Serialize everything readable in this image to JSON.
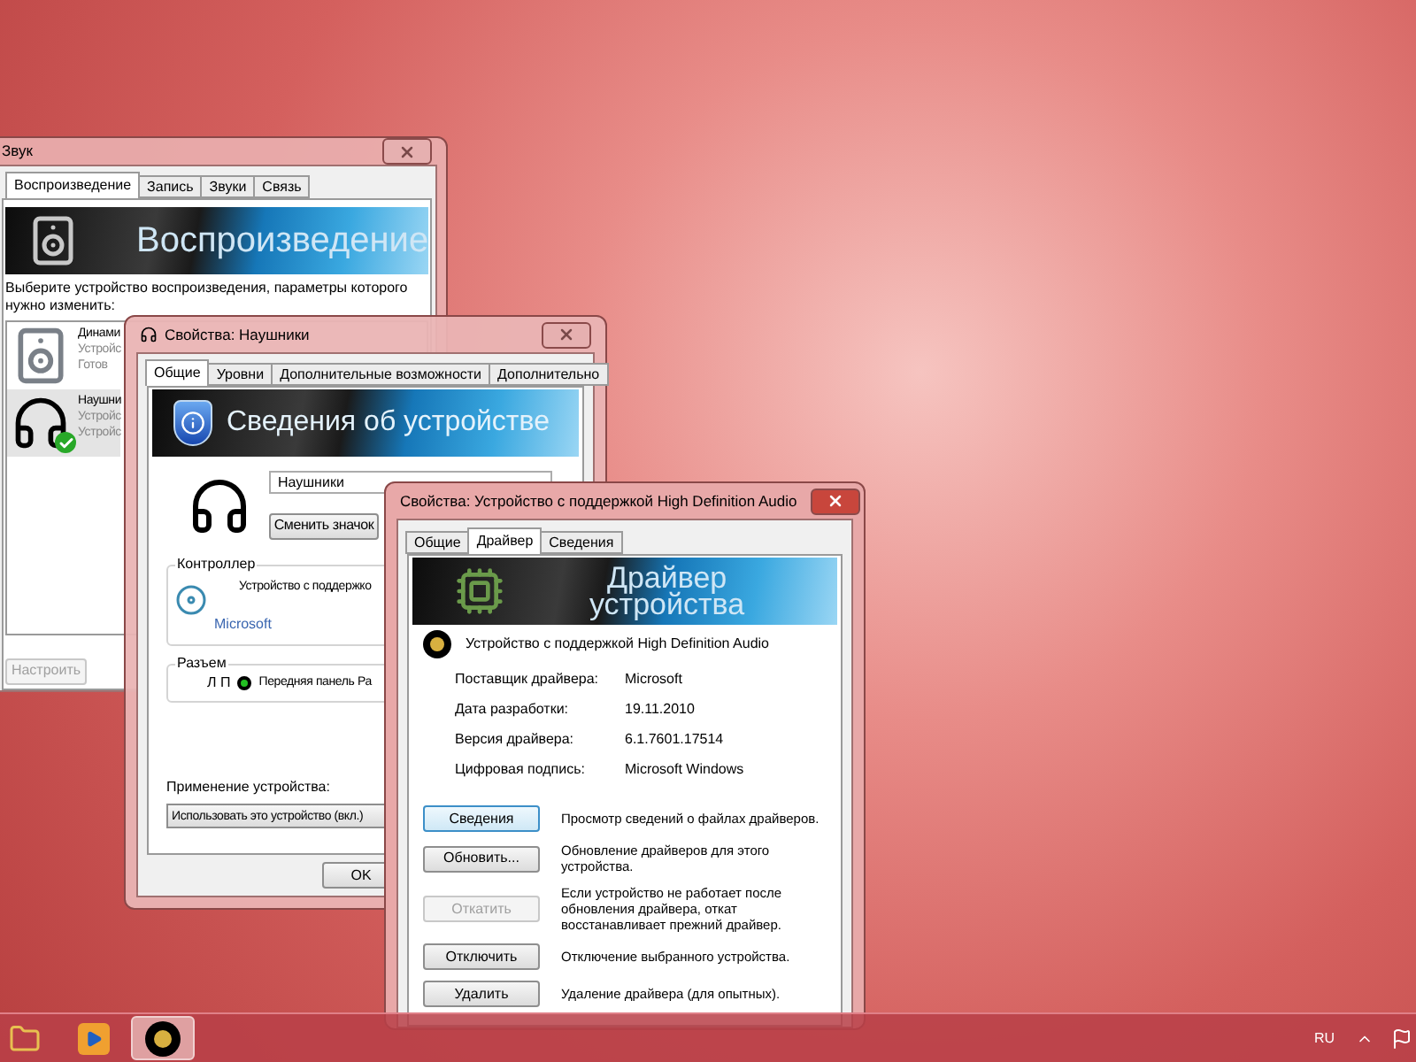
{
  "sound_window": {
    "title": "Звук",
    "tabs": [
      {
        "label": "Воспроизведение",
        "selected": true
      },
      {
        "label": "Запись",
        "selected": false
      },
      {
        "label": "Звуки",
        "selected": false
      },
      {
        "label": "Связь",
        "selected": false
      }
    ],
    "banner": "Воспроизведение",
    "prompt": "Выберите устройство воспроизведения, параметры которого нужно изменить:",
    "devices": [
      {
        "kind": "speaker",
        "name": "Динами",
        "line_2": "Устройс",
        "line_3": "Готов",
        "selected": false,
        "default": false
      },
      {
        "kind": "headphones",
        "name": "Наушни",
        "line_2": "Устройс",
        "line_3": "Устройс",
        "selected": true,
        "default": true
      }
    ],
    "configure_button": {
      "label": "Настроить",
      "disabled": true
    }
  },
  "headphones_window": {
    "title": "Свойства: Наушники",
    "tabs": [
      {
        "label": "Общие",
        "selected": true
      },
      {
        "label": "Уровни",
        "selected": false
      },
      {
        "label": "Дополнительные возможности",
        "selected": false
      },
      {
        "label": "Дополнительно",
        "selected": false
      }
    ],
    "banner": "Сведения об устройстве",
    "name_field": "Наушники",
    "change_icon_button": "Сменить значок",
    "controller": {
      "legend": "Контроллер",
      "device": "Устройство с поддержко",
      "vendor_link": "Microsoft"
    },
    "jack": {
      "legend": "Разъем",
      "channels": "Л П",
      "color": "#22c022",
      "name": "Передняя панель Ра"
    },
    "usage_label": "Применение устройства:",
    "usage_value": "Использовать это устройство (вкл.)",
    "ok_button": "OK"
  },
  "hda_window": {
    "title": "Свойства: Устройство с поддержкой High Definition Audio",
    "tabs": [
      {
        "label": "Общие",
        "selected": false
      },
      {
        "label": "Драйвер",
        "selected": true
      },
      {
        "label": "Сведения",
        "selected": false
      }
    ],
    "banner_lines": [
      "Драйвер",
      "устройства"
    ],
    "device_name": "Устройство с поддержкой High Definition Audio",
    "properties": [
      {
        "label": "Поставщик драйвера:",
        "value": "Microsoft"
      },
      {
        "label": "Дата разработки:",
        "value": "19.11.2010"
      },
      {
        "label": "Версия драйвера:",
        "value": "6.1.7601.17514"
      },
      {
        "label": "Цифровая подпись:",
        "value": "Microsoft Windows"
      }
    ],
    "actions": [
      {
        "button": "Сведения",
        "description": "Просмотр сведений о файлах драйверов.",
        "disabled": false,
        "focused": true
      },
      {
        "button": "Обновить...",
        "description": "Обновление драйверов для этого устройства.",
        "disabled": false,
        "focused": false
      },
      {
        "button": "Откатить",
        "description": "Если устройство не работает после обновления драйвера, откат восстанавливает прежний драйвер.",
        "disabled": true,
        "focused": false
      },
      {
        "button": "Отключить",
        "description": "Отключение выбранного устройства.",
        "disabled": false,
        "focused": false
      },
      {
        "button": "Удалить",
        "description": "Удаление драйвера (для опытных).",
        "disabled": false,
        "focused": false
      }
    ]
  },
  "taskbar": {
    "items": [
      {
        "kind": "folder",
        "selected": false
      },
      {
        "kind": "media",
        "selected": false
      },
      {
        "kind": "sound",
        "selected": true
      }
    ],
    "language": "RU"
  }
}
